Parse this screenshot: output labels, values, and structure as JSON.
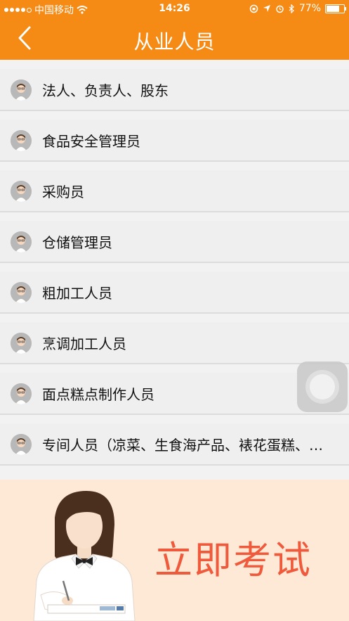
{
  "status_bar": {
    "carrier": "中国移动",
    "time": "14:26",
    "battery": "77%",
    "battery_level": 0.77
  },
  "header": {
    "title": "从业人员",
    "back_icon": "chevron-left-icon"
  },
  "list": {
    "items": [
      {
        "label": "法人、负责人、股东"
      },
      {
        "label": "食品安全管理员"
      },
      {
        "label": "采购员"
      },
      {
        "label": "仓储管理员"
      },
      {
        "label": "粗加工人员"
      },
      {
        "label": "烹调加工人员"
      },
      {
        "label": "面点糕点制作人员"
      },
      {
        "label": "专间人员（凉菜、生食海产品、裱花蛋糕、…"
      }
    ]
  },
  "banner": {
    "cta": "立即考试"
  },
  "colors": {
    "header_bg": "#f58a14",
    "cta_text": "#f05a3c",
    "banner_bg": "#fde9d5"
  }
}
